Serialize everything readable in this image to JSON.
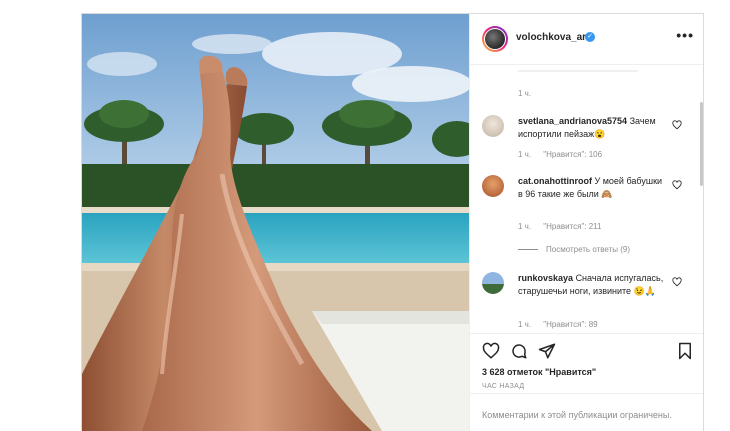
{
  "post": {
    "username": "volochkova_art",
    "verified_icon": "verified-badge-icon",
    "more_icon": "more-options-icon",
    "likes_text": "3 628 отметок \"Нравится\"",
    "time_ago": "ЧАС НАЗАД",
    "restricted_text": "Комментарии к этой публикации ограничены."
  },
  "comments": {
    "top_time": "1 ч.",
    "items": [
      {
        "username": "svetlana_andrianova5754",
        "text": "Зачем испортили пейзаж😮",
        "time": "1 ч.",
        "likes": "\"Нравится\": 106",
        "avatar_color": "#d8cfc4"
      },
      {
        "username": "cat.onahottinroof",
        "text": "У моей бабушки в 96 такие же были 🙈",
        "time": "1 ч.",
        "likes": "\"Нравится\": 211",
        "avatar_color": "#c8723a",
        "replies": "Посмотреть ответы (9)"
      },
      {
        "username": "runkovskaya",
        "text": "Сначала испугалась, старушечьи ноги, извините 😉🙏",
        "time": "1 ч.",
        "likes": "\"Нравится\": 89",
        "avatar_color": "#5d8fc7"
      }
    ]
  },
  "actions": {
    "like_icon": "heart-icon",
    "comment_icon": "comment-icon",
    "share_icon": "share-icon",
    "save_icon": "bookmark-icon"
  },
  "colors": {
    "text": "#262626",
    "muted": "#8e8e8e",
    "border": "#dbdbdb",
    "verified": "#3897f0"
  }
}
